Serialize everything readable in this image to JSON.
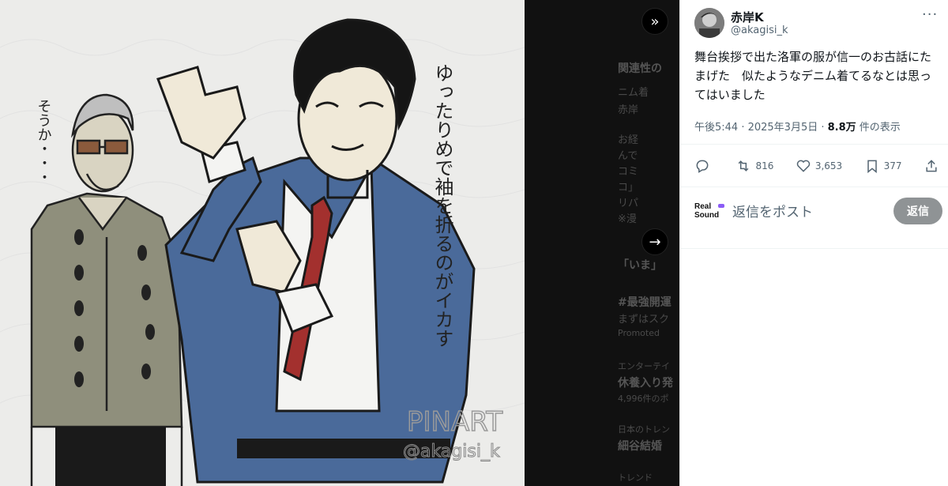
{
  "media": {
    "vertical_text_right": "ゆったりめで袖を折るのがイカす",
    "vertical_text_left": "そうか・・・",
    "signature_handle": "@akagisi_k",
    "signature_art": "PINART"
  },
  "backdrop": {
    "expand_icon": "»",
    "arrow_icon": "→",
    "snippets": [
      "関連性の",
      "ニム着",
      "赤岸",
      "お経",
      "んで",
      "コミ",
      "コ」",
      "リパ",
      "※漫",
      "「いま」",
      "#最強開運",
      "まずはスク",
      "Promoted",
      "エンターテイ",
      "休養入り発",
      "4,996件のポ",
      "日本のトレン",
      "細谷結婚",
      "トレンド"
    ]
  },
  "tweet": {
    "display_name": "赤岸K",
    "handle": "@akagisi_k",
    "more_icon": "···",
    "text": "舞台挨拶で出た洛軍の服が信一のお古話にたまげた　似たようなデニム着てるなとは思ってはいました",
    "time": "午後5:44 · 2025年3月5日 · ",
    "views_count": "8.8万",
    "views_label": " 件の表示",
    "actions": {
      "reply_count": "",
      "retweet_count": "816",
      "like_count": "3,653",
      "bookmark_count": "377"
    },
    "reply_placeholder": "返信をポスト",
    "reply_button": "返信",
    "reply_logo_line1": "Real",
    "reply_logo_line2": "Sound"
  },
  "colors": {
    "denim": "#4a6a9a",
    "shirt_olive": "#8f8f7c",
    "tie_red": "#a3302e",
    "text_primary": "#0f1419",
    "text_secondary": "#536471"
  }
}
